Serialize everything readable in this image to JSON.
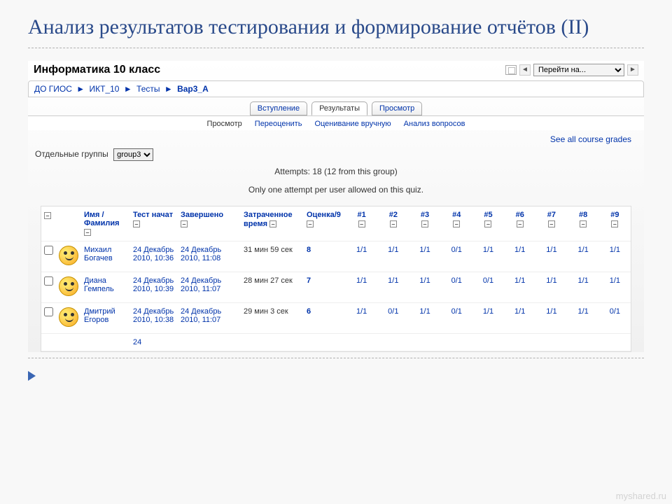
{
  "slide": {
    "title": "Анализ результатов тестирования и формирование отчётов  (II)"
  },
  "course": {
    "title": "Информатика 10 класс"
  },
  "nav": {
    "jump_label": "Перейти на...",
    "prev_glyph": "◄",
    "next_glyph": "►"
  },
  "breadcrumb": {
    "items": [
      "ДО ГИОС",
      "ИКТ_10",
      "Тесты"
    ],
    "current": "Вар3_А",
    "sep": "►"
  },
  "tabs": {
    "intro": "Вступление",
    "results": "Результаты",
    "preview": "Просмотр"
  },
  "subtabs": {
    "view": "Просмотр",
    "regrade": "Переоценить",
    "manual": "Оценивание вручную",
    "itemanalysis": "Анализ вопросов"
  },
  "see_all": "See all course grades",
  "groups": {
    "label": "Отдельные группы",
    "selected": "group3"
  },
  "attempts_line": "Attempts: 18 (12 from this group)",
  "rule_line": "Only one attempt per user allowed on this quiz.",
  "table": {
    "headers": {
      "name": "Имя / Фамилия",
      "started": "Тест начат",
      "completed": "Завершено",
      "timetaken": "Затраченное время",
      "grade": "Оценка/9",
      "q": [
        "#1",
        "#2",
        "#3",
        "#4",
        "#5",
        "#6",
        "#7",
        "#8",
        "#9"
      ]
    },
    "rows": [
      {
        "name": "Михаил Богачев",
        "started": "24 Декабрь 2010, 10:36",
        "completed": "24 Декабрь 2010, 11:08",
        "timetaken": "31 мин 59 сек",
        "grade": "8",
        "q": [
          "1/1",
          "1/1",
          "1/1",
          "0/1",
          "1/1",
          "1/1",
          "1/1",
          "1/1",
          "1/1"
        ]
      },
      {
        "name": "Диана Гемпель",
        "started": "24 Декабрь 2010, 10:39",
        "completed": "24 Декабрь 2010, 11:07",
        "timetaken": "28 мин 27 сек",
        "grade": "7",
        "q": [
          "1/1",
          "1/1",
          "1/1",
          "0/1",
          "0/1",
          "1/1",
          "1/1",
          "1/1",
          "1/1"
        ]
      },
      {
        "name": "Дмитрий Егоров",
        "started": "24 Декабрь 2010, 10:38",
        "completed": "24 Декабрь 2010, 11:07",
        "timetaken": "29 мин 3 сек",
        "grade": "6",
        "q": [
          "1/1",
          "0/1",
          "1/1",
          "0/1",
          "1/1",
          "1/1",
          "1/1",
          "1/1",
          "0/1"
        ]
      }
    ],
    "partial_next": "24"
  },
  "watermark": "myshared.ru",
  "minus_glyph": "–"
}
